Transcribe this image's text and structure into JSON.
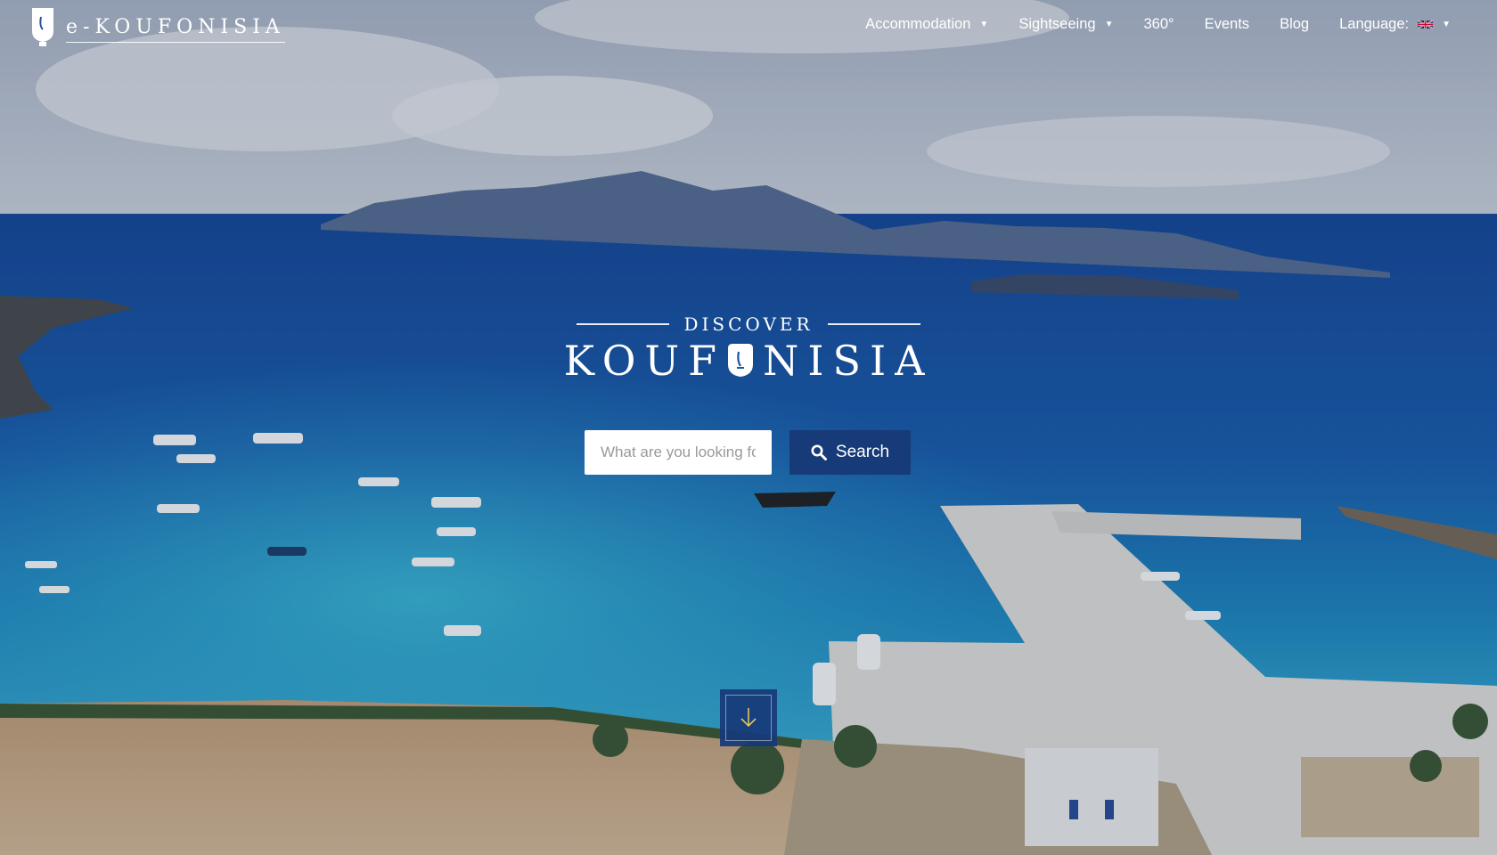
{
  "brand": {
    "logo_text": "e-KOUFONISIA"
  },
  "nav": {
    "items": [
      {
        "label": "Accommodation",
        "has_dropdown": true
      },
      {
        "label": "Sightseeing",
        "has_dropdown": true
      },
      {
        "label": "360°",
        "has_dropdown": false
      },
      {
        "label": "Events",
        "has_dropdown": false
      },
      {
        "label": "Blog",
        "has_dropdown": false
      },
      {
        "label": "Language:",
        "has_dropdown": true,
        "icon": "uk-flag-icon"
      }
    ]
  },
  "hero": {
    "discover_label": "DISCOVER",
    "title_part1": "KOUF",
    "title_part2": "NISIA"
  },
  "search": {
    "placeholder": "What are you looking for?",
    "button_label": "Search",
    "button_icon": "search-icon"
  },
  "scroll_button": {
    "icon": "arrow-down-icon"
  },
  "colors": {
    "primary": "#173a78",
    "sea_deep": "#1e55a8",
    "sea_light": "#2aa3d4",
    "sand": "#c9a77e"
  }
}
